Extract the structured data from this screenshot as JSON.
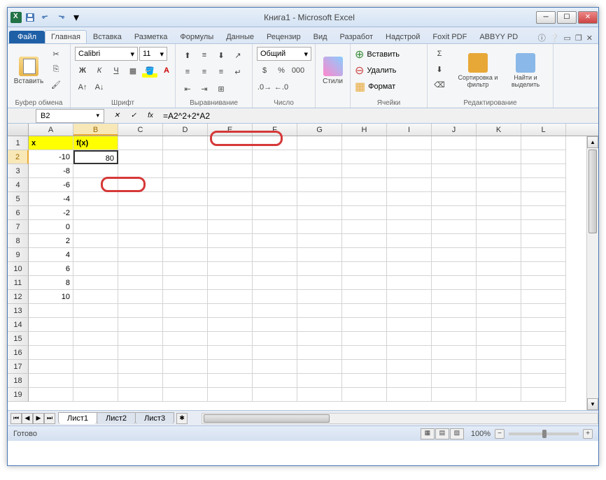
{
  "title": "Книга1 - Microsoft Excel",
  "tabs": {
    "file": "Файл",
    "items": [
      "Главная",
      "Вставка",
      "Разметка",
      "Формулы",
      "Данные",
      "Рецензир",
      "Вид",
      "Разработ",
      "Надстрой",
      "Foxit PDF",
      "ABBYY PD"
    ],
    "active": 0
  },
  "ribbon": {
    "clipboard": {
      "label": "Буфер обмена",
      "paste": "Вставить"
    },
    "font": {
      "label": "Шрифт",
      "name": "Calibri",
      "size": "11"
    },
    "alignment": {
      "label": "Выравнивание"
    },
    "number": {
      "label": "Число",
      "format": "Общий"
    },
    "styles": {
      "label": "Стили",
      "btn": "Стили"
    },
    "cells": {
      "label": "Ячейки",
      "insert": "Вставить",
      "delete": "Удалить",
      "format": "Формат"
    },
    "editing": {
      "label": "Редактирование",
      "sort": "Сортировка и фильтр",
      "find": "Найти и выделить"
    }
  },
  "nameBox": "B2",
  "formula": "=A2^2+2*A2",
  "columns": [
    "A",
    "B",
    "C",
    "D",
    "E",
    "F",
    "G",
    "H",
    "I",
    "J",
    "K",
    "L"
  ],
  "selectedCol": "B",
  "selectedRow": 2,
  "activeCell": "B2",
  "headers": {
    "A": "x",
    "B": "f(x)"
  },
  "data": {
    "A": [
      "-10",
      "-8",
      "-6",
      "-4",
      "-2",
      "0",
      "2",
      "4",
      "6",
      "8",
      "10"
    ],
    "B": [
      "80",
      "",
      "",
      "",
      "",
      "",
      "",
      "",
      "",
      "",
      ""
    ]
  },
  "rowCount": 19,
  "sheets": [
    "Лист1",
    "Лист2",
    "Лист3"
  ],
  "activeSheet": 0,
  "status": "Готово",
  "zoom": "100%"
}
